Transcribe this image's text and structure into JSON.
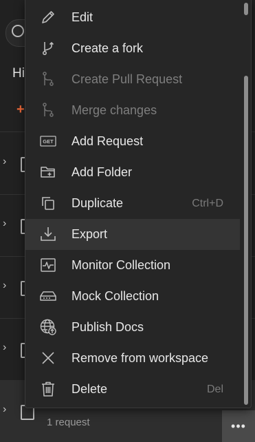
{
  "background": {
    "section_heading_partial": "Hi",
    "add_glyph": "+",
    "last_row_subtitle": "1 request",
    "more_button_glyph": "•••"
  },
  "menu": {
    "items": [
      {
        "label": "Edit",
        "icon": "pencil-icon",
        "shortcut": "",
        "disabled": false
      },
      {
        "label": "Create a fork",
        "icon": "fork-icon",
        "shortcut": "",
        "disabled": false
      },
      {
        "label": "Create Pull Request",
        "icon": "pull-request-icon",
        "shortcut": "",
        "disabled": true
      },
      {
        "label": "Merge changes",
        "icon": "merge-icon",
        "shortcut": "",
        "disabled": true
      },
      {
        "label": "Add Request",
        "icon": "get-request-icon",
        "icon_text": "GET",
        "shortcut": "",
        "disabled": false
      },
      {
        "label": "Add Folder",
        "icon": "folder-add-icon",
        "shortcut": "",
        "disabled": false
      },
      {
        "label": "Duplicate",
        "icon": "duplicate-icon",
        "shortcut": "Ctrl+D",
        "disabled": false
      },
      {
        "label": "Export",
        "icon": "download-icon",
        "shortcut": "",
        "disabled": false,
        "active": true
      },
      {
        "label": "Monitor Collection",
        "icon": "monitor-icon",
        "shortcut": "",
        "disabled": false
      },
      {
        "label": "Mock Collection",
        "icon": "mock-server-icon",
        "shortcut": "",
        "disabled": false
      },
      {
        "label": "Publish Docs",
        "icon": "globe-publish-icon",
        "shortcut": "",
        "disabled": false
      },
      {
        "label": "Remove from workspace",
        "icon": "close-icon",
        "shortcut": "",
        "disabled": false
      },
      {
        "label": "Delete",
        "icon": "trash-icon",
        "shortcut": "Del",
        "disabled": false
      }
    ]
  },
  "colors": {
    "menu_bg": "#262626",
    "text": "#e8e8e8",
    "disabled_text": "#7e7e7e",
    "accent": "#f26b3a"
  }
}
